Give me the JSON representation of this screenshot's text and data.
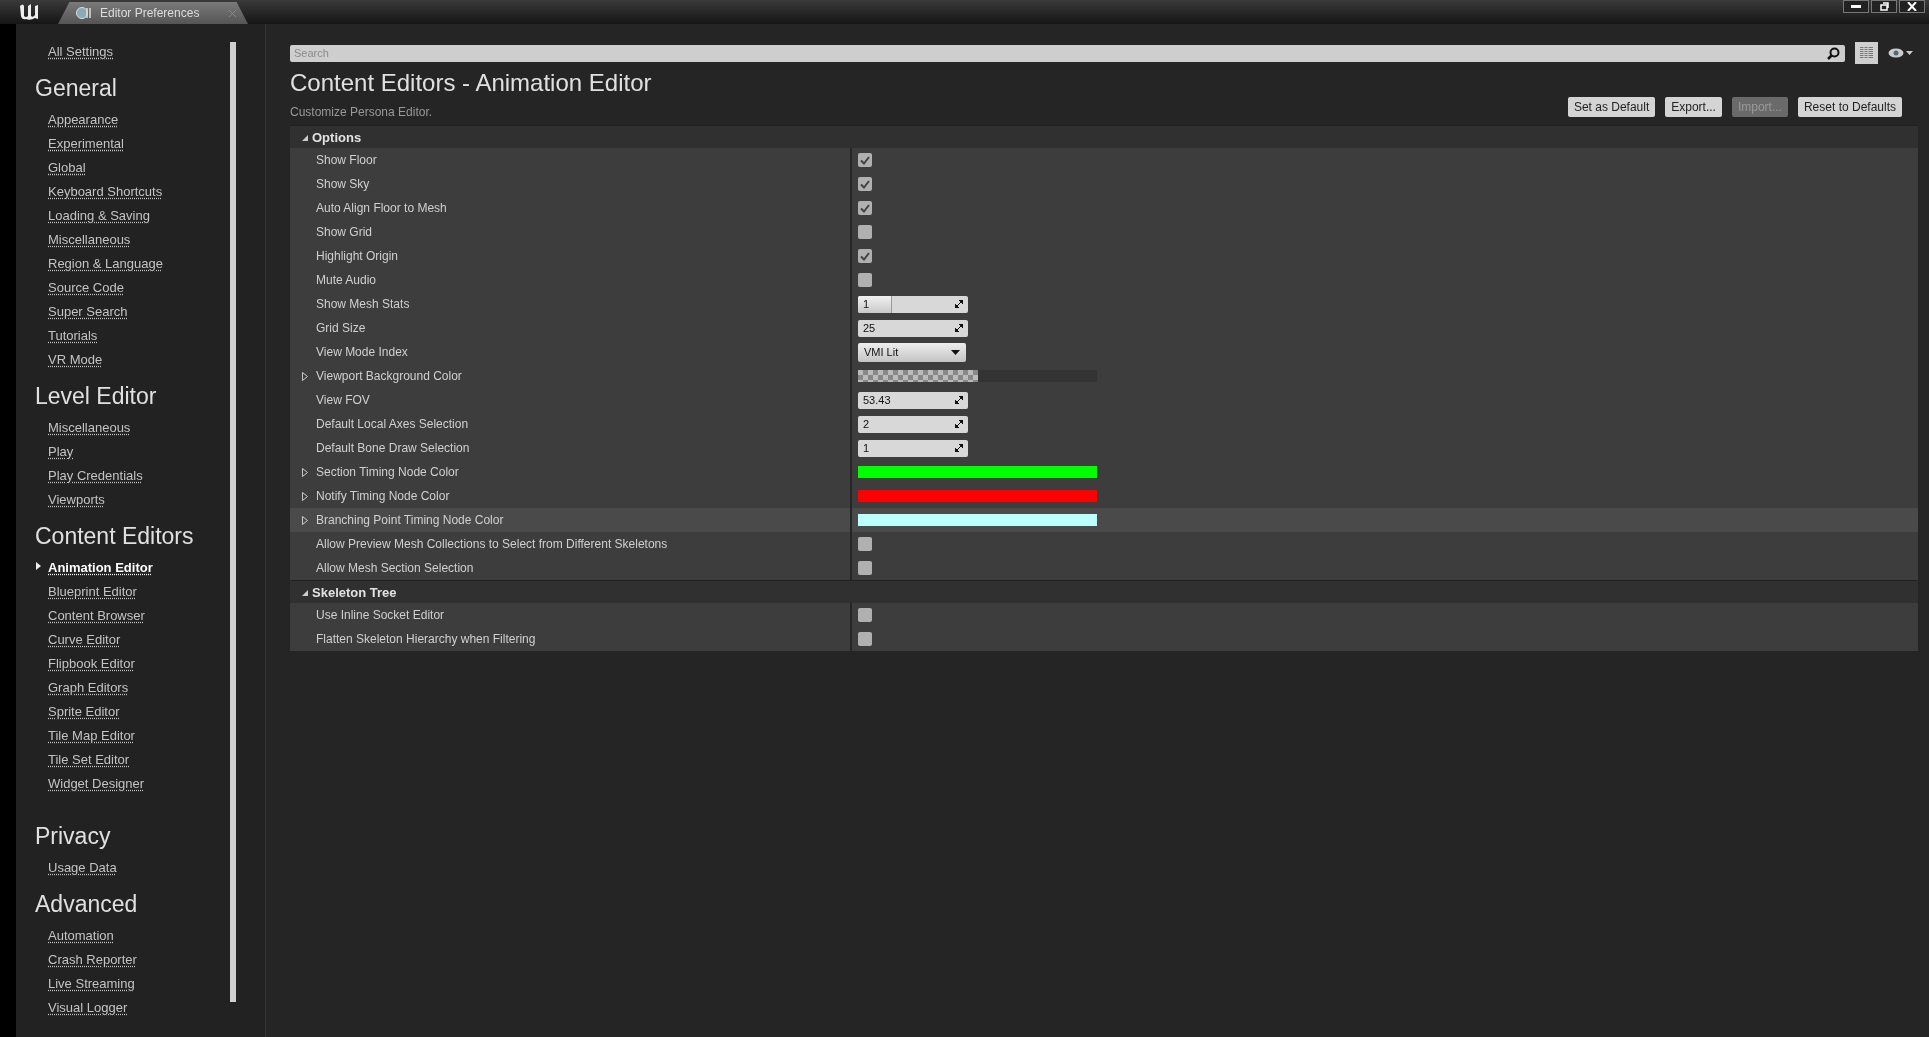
{
  "window": {
    "tab_title": "Editor Preferences"
  },
  "sidebar": {
    "top_link": "All Settings",
    "groups": [
      {
        "title": "General",
        "items": [
          {
            "label": "Appearance",
            "selected": false
          },
          {
            "label": "Experimental",
            "selected": false
          },
          {
            "label": "Global",
            "selected": false
          },
          {
            "label": "Keyboard Shortcuts",
            "selected": false
          },
          {
            "label": "Loading & Saving",
            "selected": false
          },
          {
            "label": "Miscellaneous",
            "selected": false
          },
          {
            "label": "Region & Language",
            "selected": false
          },
          {
            "label": "Source Code",
            "selected": false
          },
          {
            "label": "Super Search",
            "selected": false
          },
          {
            "label": "Tutorials",
            "selected": false
          },
          {
            "label": "VR Mode",
            "selected": false
          }
        ]
      },
      {
        "title": "Level Editor",
        "items": [
          {
            "label": "Miscellaneous",
            "selected": false
          },
          {
            "label": "Play",
            "selected": false
          },
          {
            "label": "Play Credentials",
            "selected": false
          },
          {
            "label": "Viewports",
            "selected": false
          }
        ]
      },
      {
        "title": "Content Editors",
        "items": [
          {
            "label": "Animation Editor",
            "selected": true
          },
          {
            "label": "Blueprint Editor",
            "selected": false
          },
          {
            "label": "Content Browser",
            "selected": false
          },
          {
            "label": "Curve Editor",
            "selected": false
          },
          {
            "label": "Flipbook Editor",
            "selected": false
          },
          {
            "label": "Graph Editors",
            "selected": false
          },
          {
            "label": "Sprite Editor",
            "selected": false
          },
          {
            "label": "Tile Map Editor",
            "selected": false
          },
          {
            "label": "Tile Set Editor",
            "selected": false
          },
          {
            "label": "Widget Designer",
            "selected": false
          }
        ]
      },
      {
        "title": "Privacy",
        "items": [
          {
            "label": "Usage Data",
            "selected": false
          }
        ]
      },
      {
        "title": "Advanced",
        "items": [
          {
            "label": "Automation",
            "selected": false
          },
          {
            "label": "Crash Reporter",
            "selected": false
          },
          {
            "label": "Live Streaming",
            "selected": false
          },
          {
            "label": "Visual Logger",
            "selected": false
          }
        ]
      }
    ]
  },
  "search": {
    "placeholder": "Search"
  },
  "page": {
    "title": "Content Editors - Animation Editor",
    "subtitle": "Customize Persona Editor."
  },
  "buttons": [
    {
      "label": "Set as Default",
      "disabled": false
    },
    {
      "label": "Export...",
      "disabled": false
    },
    {
      "label": "Import...",
      "disabled": true
    },
    {
      "label": "Reset to Defaults",
      "disabled": false
    }
  ],
  "sections": [
    {
      "title": "Options",
      "expanded": true,
      "rows": [
        {
          "label": "Show Floor",
          "kind": "checkbox",
          "checked": true,
          "expandable": false,
          "highlighted": false
        },
        {
          "label": "Show Sky",
          "kind": "checkbox",
          "checked": true,
          "expandable": false,
          "highlighted": false
        },
        {
          "label": "Auto Align Floor to Mesh",
          "kind": "checkbox",
          "checked": true,
          "expandable": false,
          "highlighted": false
        },
        {
          "label": "Show Grid",
          "kind": "checkbox",
          "checked": false,
          "expandable": false,
          "highlighted": false
        },
        {
          "label": "Highlight Origin",
          "kind": "checkbox",
          "checked": true,
          "expandable": false,
          "highlighted": false
        },
        {
          "label": "Mute Audio",
          "kind": "checkbox",
          "checked": false,
          "expandable": false,
          "highlighted": false
        },
        {
          "label": "Show Mesh Stats",
          "kind": "slider",
          "value": "1",
          "level": 0.3,
          "expandable": false,
          "highlighted": false
        },
        {
          "label": "Grid Size",
          "kind": "spin",
          "value": "25",
          "expandable": false,
          "highlighted": false
        },
        {
          "label": "View Mode Index",
          "kind": "dropdown",
          "value": "VMI Lit",
          "expandable": false,
          "highlighted": false
        },
        {
          "label": "Viewport Background Color",
          "kind": "alpha_color",
          "level": 0.5,
          "expandable": true,
          "highlighted": false
        },
        {
          "label": "View FOV",
          "kind": "spin",
          "value": "53.43",
          "expandable": false,
          "highlighted": false
        },
        {
          "label": "Default Local Axes Selection",
          "kind": "spin",
          "value": "2",
          "expandable": false,
          "highlighted": false
        },
        {
          "label": "Default Bone Draw Selection",
          "kind": "spin",
          "value": "1",
          "expandable": false,
          "highlighted": false
        },
        {
          "label": "Section Timing Node Color",
          "kind": "color",
          "color": "#00ff00",
          "expandable": true,
          "highlighted": false
        },
        {
          "label": "Notify Timing Node Color",
          "kind": "color",
          "color": "#ff0000",
          "expandable": true,
          "highlighted": false
        },
        {
          "label": "Branching Point Timing Node Color",
          "kind": "color",
          "color": "#bbffff",
          "expandable": true,
          "highlighted": true
        },
        {
          "label": "Allow Preview Mesh Collections to Select from Different Skeletons",
          "kind": "checkbox",
          "checked": false,
          "expandable": false,
          "highlighted": false
        },
        {
          "label": "Allow Mesh Section Selection",
          "kind": "checkbox",
          "checked": false,
          "expandable": false,
          "highlighted": false
        }
      ]
    },
    {
      "title": "Skeleton Tree",
      "expanded": true,
      "rows": [
        {
          "label": "Use Inline Socket Editor",
          "kind": "checkbox",
          "checked": false,
          "expandable": false,
          "highlighted": false
        },
        {
          "label": "Flatten Skeleton Hierarchy when Filtering",
          "kind": "checkbox",
          "checked": false,
          "expandable": false,
          "highlighted": false
        }
      ]
    }
  ]
}
